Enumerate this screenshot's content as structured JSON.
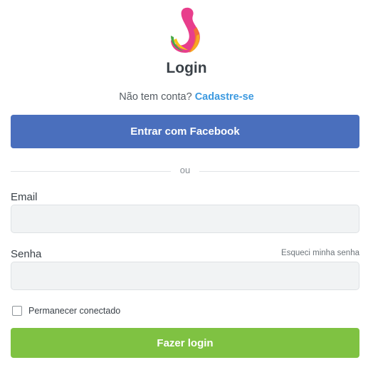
{
  "header": {
    "logo_icon": "colorful-swirl-logo",
    "title": "Login"
  },
  "signup": {
    "prompt": "Não tem conta?",
    "link": "Cadastre-se"
  },
  "facebook_button": {
    "label": "Entrar com Facebook",
    "color": "#4a6fbd"
  },
  "divider": {
    "text": "ou"
  },
  "form": {
    "email_label": "Email",
    "email_value": "",
    "password_label": "Senha",
    "password_value": "",
    "forgot_link": "Esqueci minha senha",
    "remember_label": "Permanecer conectado",
    "remember_checked": false
  },
  "login_button": {
    "label": "Fazer login",
    "color": "#7fc242"
  },
  "colors": {
    "link": "#3d9ae0",
    "input_bg": "#f1f3f4"
  }
}
